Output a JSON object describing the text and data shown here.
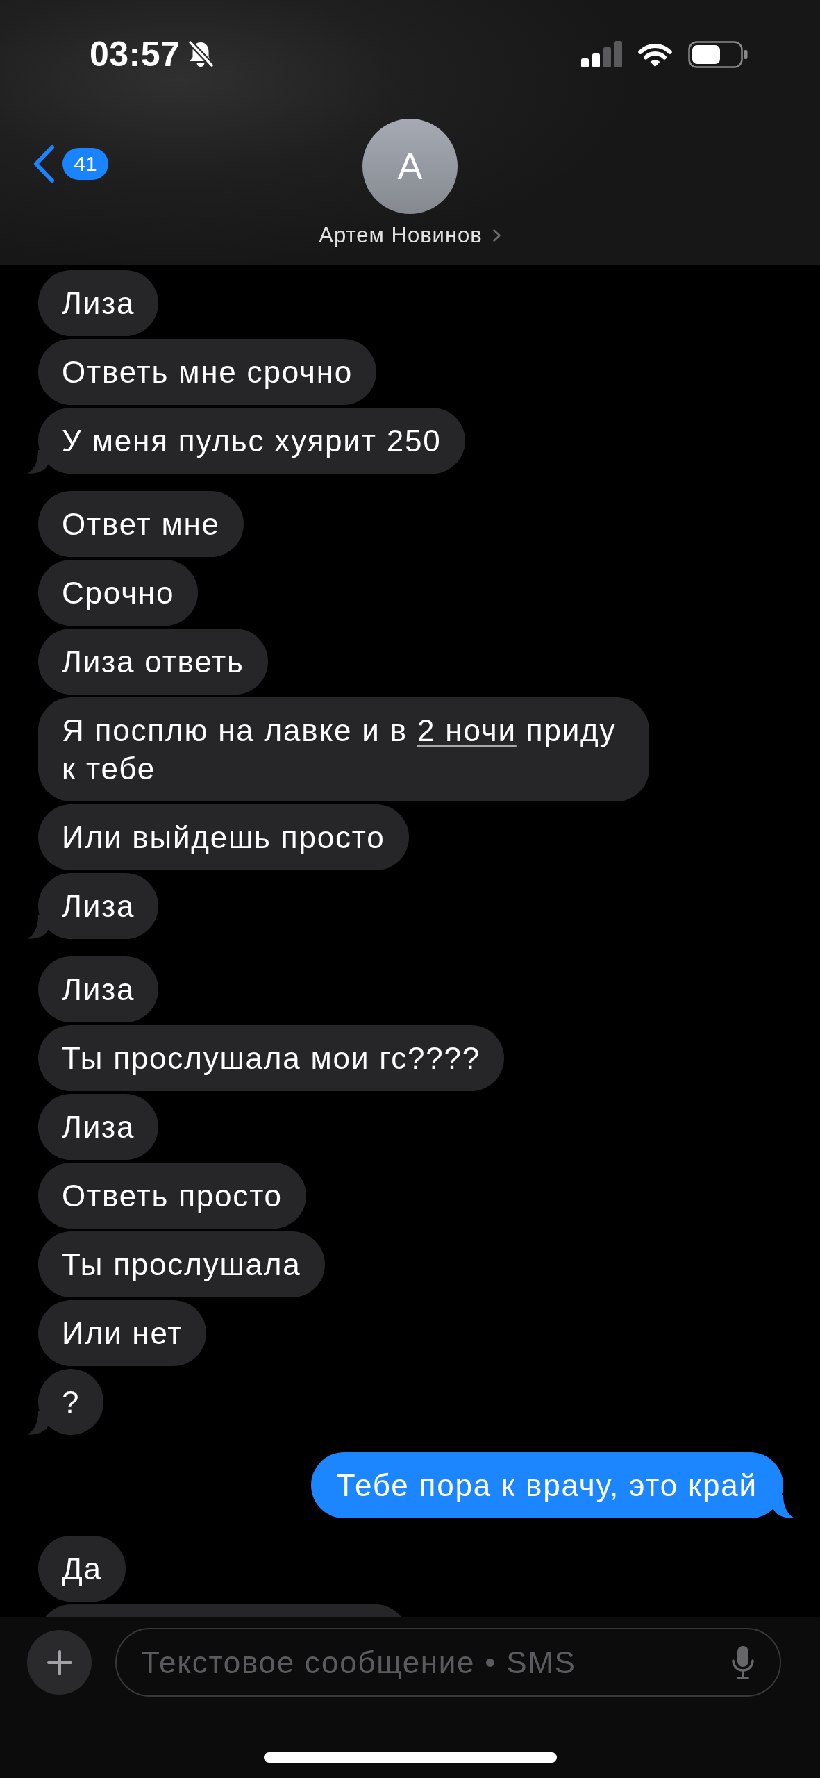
{
  "status_bar": {
    "time": "03:57",
    "silent": true
  },
  "header": {
    "back_badge": "41",
    "avatar_initial": "А",
    "contact_name": "Артем Новинов"
  },
  "messages": [
    {
      "kind": "bubble",
      "outgoing": false,
      "tail": false,
      "text": "Лиза"
    },
    {
      "kind": "bubble",
      "outgoing": false,
      "tail": false,
      "text": "Ответь мне срочно"
    },
    {
      "kind": "bubble",
      "outgoing": false,
      "tail": true,
      "text": "У меня пульс хуярит 250"
    },
    {
      "kind": "bubble",
      "outgoing": false,
      "tail": false,
      "text": "Ответ мне"
    },
    {
      "kind": "bubble",
      "outgoing": false,
      "tail": false,
      "text": "Срочно"
    },
    {
      "kind": "bubble",
      "outgoing": false,
      "tail": false,
      "text": "Лиза ответь"
    },
    {
      "kind": "bubble",
      "outgoing": false,
      "tail": false,
      "parts": [
        {
          "kind": "plain",
          "text": "Я посплю на лавке и в "
        },
        {
          "kind": "link",
          "text": "2 ночи"
        },
        {
          "kind": "plain",
          "text": " приду к тебе"
        }
      ]
    },
    {
      "kind": "bubble",
      "outgoing": false,
      "tail": false,
      "text": "Или выйдешь просто"
    },
    {
      "kind": "bubble",
      "outgoing": false,
      "tail": true,
      "text": "Лиза"
    },
    {
      "kind": "bubble",
      "outgoing": false,
      "tail": false,
      "text": "Лиза"
    },
    {
      "kind": "bubble",
      "outgoing": false,
      "tail": false,
      "text": "Ты прослушала мои гс????"
    },
    {
      "kind": "bubble",
      "outgoing": false,
      "tail": false,
      "text": "Лиза"
    },
    {
      "kind": "bubble",
      "outgoing": false,
      "tail": false,
      "text": "Ответь просто"
    },
    {
      "kind": "bubble",
      "outgoing": false,
      "tail": false,
      "text": "Ты прослушала"
    },
    {
      "kind": "bubble",
      "outgoing": false,
      "tail": false,
      "text": "Или нет"
    },
    {
      "kind": "bubble",
      "outgoing": false,
      "tail": true,
      "text": "?"
    },
    {
      "kind": "bubble",
      "outgoing": true,
      "tail": true,
      "text": "Тебе пора к врачу, это край"
    },
    {
      "kind": "bubble",
      "outgoing": false,
      "tail": false,
      "text": "Да"
    },
    {
      "kind": "covered",
      "outgoing": false
    }
  ],
  "composer": {
    "placeholder": "Текстовое сообщение • SMS"
  }
}
